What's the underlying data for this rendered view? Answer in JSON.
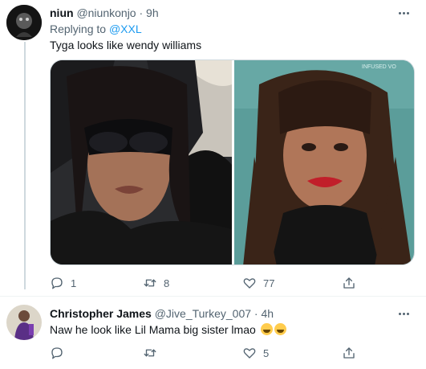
{
  "tweet1": {
    "display_name": "niun",
    "handle": "@niunkonjo",
    "separator": "·",
    "time": "9h",
    "replying_prefix": "Replying to",
    "replying_to": "@XXL",
    "text": "Tyga looks like wendy williams",
    "media_watermark": "INFUSED VO",
    "actions": {
      "replies": "1",
      "retweets": "8",
      "likes": "77"
    }
  },
  "tweet2": {
    "display_name": "Christopher James",
    "handle": "@Jive_Turkey_007",
    "separator": "·",
    "time": "4h",
    "text": "Naw he look like Lil Mama big sister lmao",
    "emoji": "rolling-on-floor-laughing",
    "actions": {
      "replies": "",
      "retweets": "",
      "likes": "5"
    }
  },
  "icons": [
    "more-icon",
    "reply-icon",
    "retweet-icon",
    "like-icon",
    "share-icon"
  ],
  "colors": {
    "text": "#0f1419",
    "muted": "#536471",
    "link": "#1d9bf0",
    "border": "#cfd9de"
  }
}
